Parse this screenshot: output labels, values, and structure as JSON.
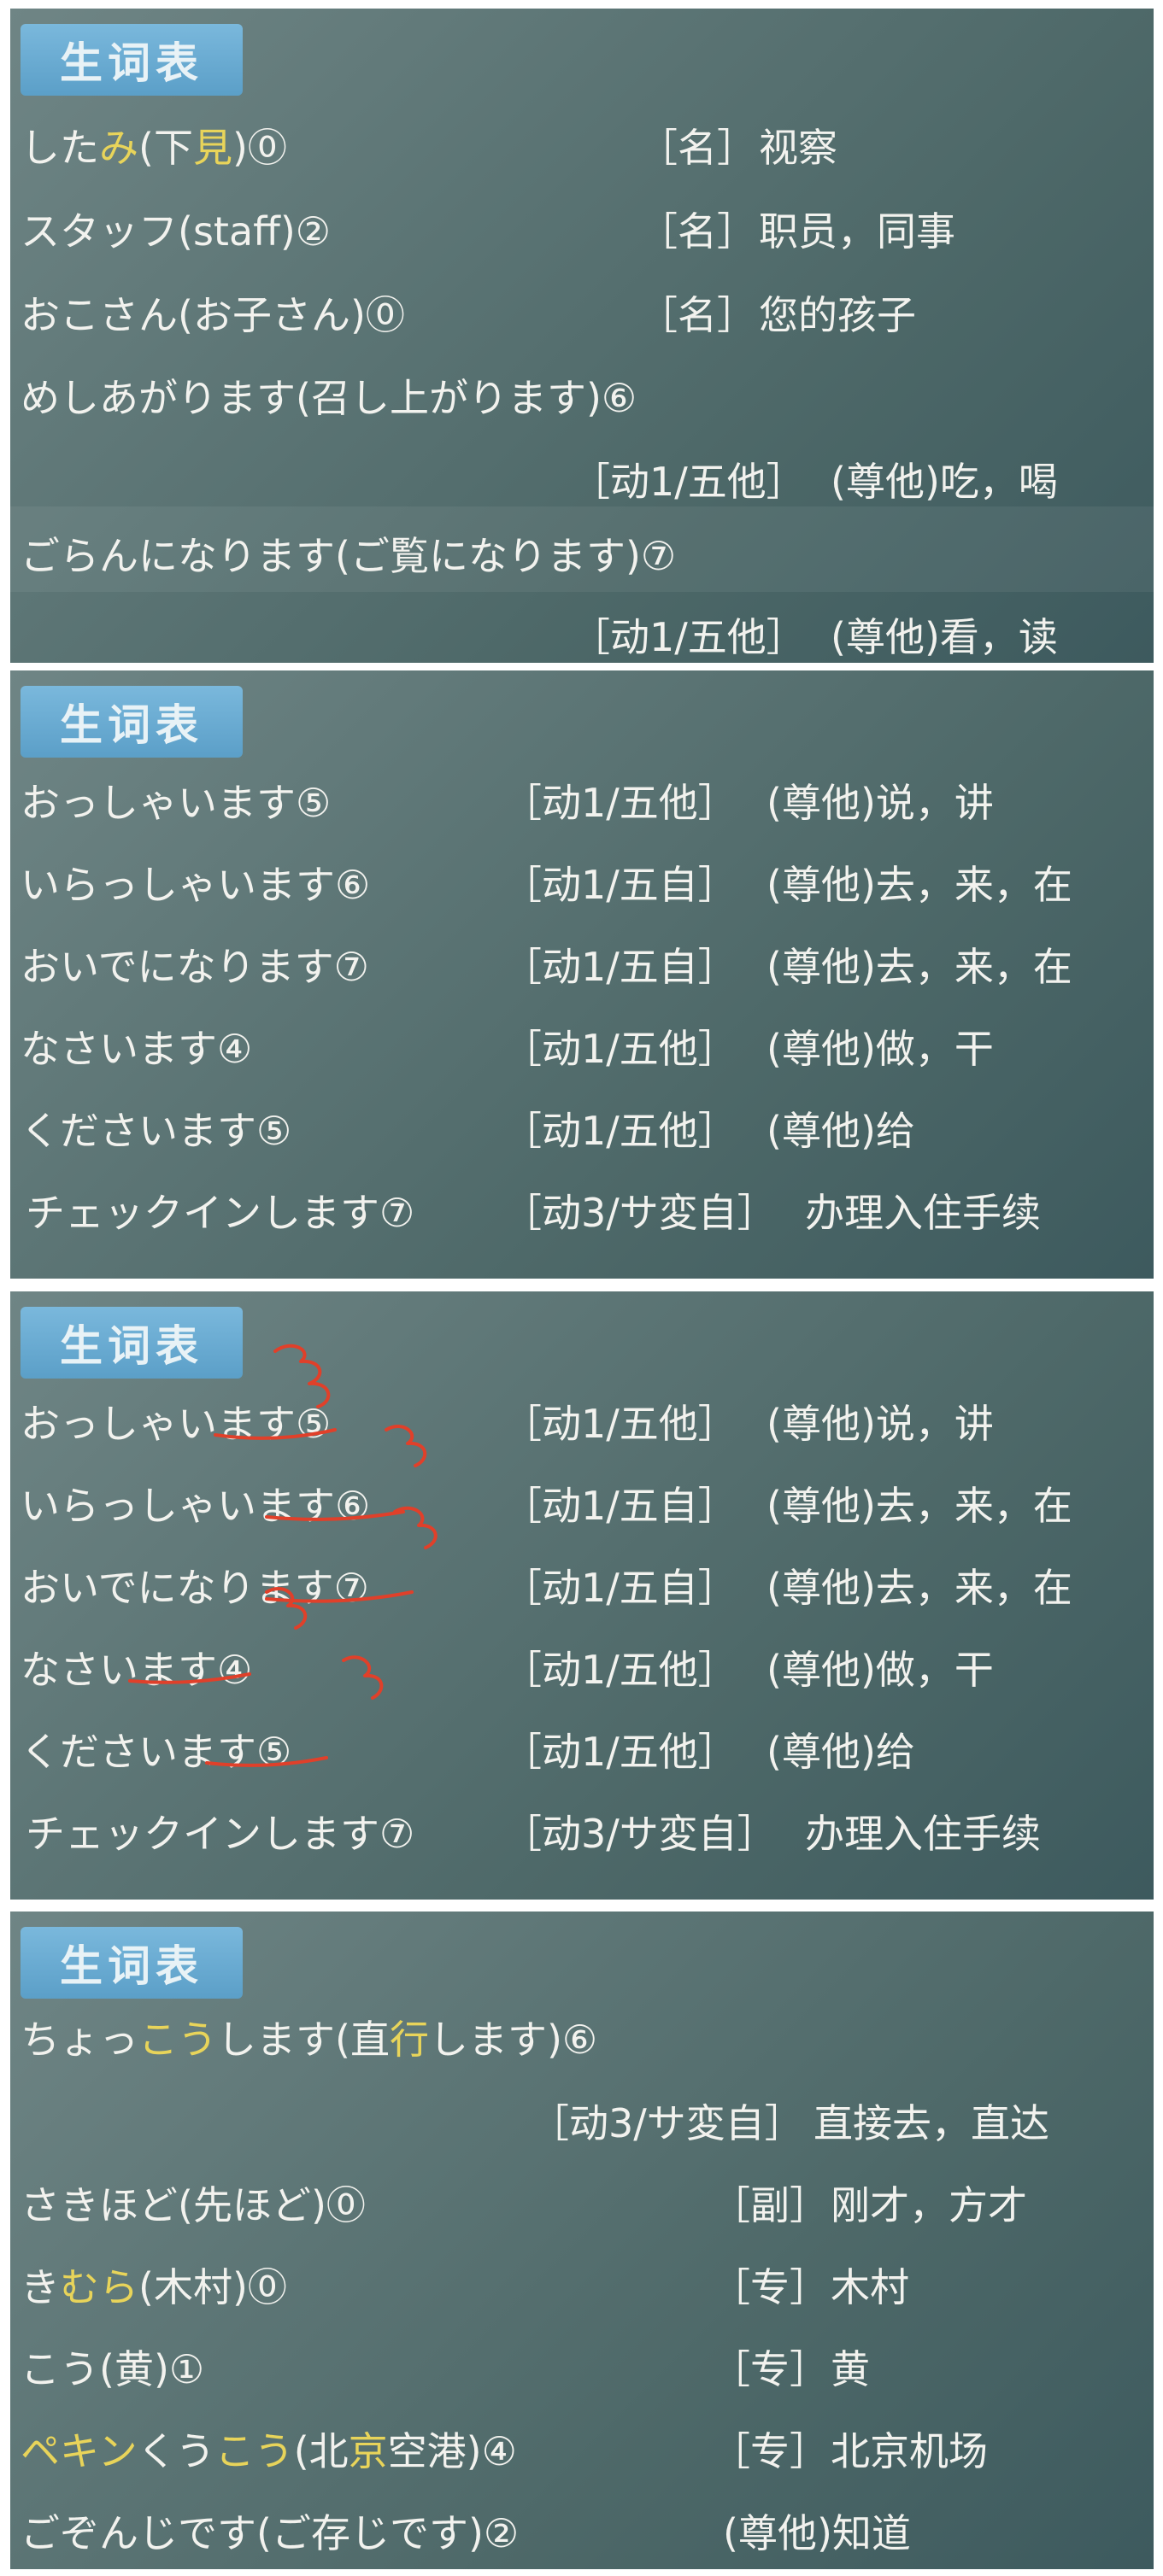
{
  "panels": [
    {
      "badge": "生词表",
      "rows": [
        {
          "kana_a": "した",
          "kana_b": "み",
          "paren_a": "(下",
          "paren_b": "見",
          "paren_c": ")",
          "accent": "⓪",
          "pos": "［名］",
          "gloss": "视察"
        },
        {
          "word": "スタッフ(staff)②",
          "pos": "［名］",
          "gloss": "职员，同事"
        },
        {
          "word": "おこさん(お子さん)⓪",
          "pos": "［名］",
          "gloss": "您的孩子"
        },
        {
          "word": "めしあがります(召し上がります)⑥",
          "pos": "［动1/五他］",
          "gloss": "(尊他)吃，喝"
        },
        {
          "word": "ごらんになります(ご覧になります)⑦",
          "pos": "［动1/五他］",
          "gloss": "(尊他)看，读"
        }
      ]
    },
    {
      "badge": "生词表",
      "rows": [
        {
          "word": "おっしゃいます⑤",
          "pos": "［动1/五他］",
          "gloss": "(尊他)说，讲"
        },
        {
          "word": "いらっしゃいます⑥",
          "pos": "［动1/五自］",
          "gloss": "(尊他)去，来，在"
        },
        {
          "word": "おいでになります⑦",
          "pos": "［动1/五自］",
          "gloss": "(尊他)去，来，在"
        },
        {
          "word": "なさいます④",
          "pos": "［动1/五他］",
          "gloss": "(尊他)做，干"
        },
        {
          "word": "くださいます⑤",
          "pos": "［动1/五他］",
          "gloss": "(尊他)给"
        },
        {
          "word": "チェックインします⑦",
          "pos": "［动3/サ変自］",
          "gloss": "办理入住手续"
        }
      ]
    },
    {
      "badge": "生词表",
      "rows": [
        {
          "word": "おっしゃいます⑤",
          "pos": "［动1/五他］",
          "gloss": "(尊他)说，讲"
        },
        {
          "word": "いらっしゃいます⑥",
          "pos": "［动1/五自］",
          "gloss": "(尊他)去，来，在"
        },
        {
          "word": "おいでになります⑦",
          "pos": "［动1/五自］",
          "gloss": "(尊他)去，来，在"
        },
        {
          "word": "なさいます④",
          "pos": "［动1/五他］",
          "gloss": "(尊他)做，干"
        },
        {
          "word": "くださいます⑤",
          "pos": "［动1/五他］",
          "gloss": "(尊他)给"
        },
        {
          "word": "チェックインします⑦",
          "pos": "［动3/サ変自］",
          "gloss": "办理入住手续"
        }
      ],
      "annotation_color": "#e0402a"
    },
    {
      "badge": "生词表",
      "rows": [
        {
          "w1": "ちょっ",
          "w2": "こう",
          "w3": "します(直",
          "w4": "行",
          "w5": "します)⑥",
          "pos": "［动3/サ変自］",
          "gloss": "直接去，直达"
        },
        {
          "word": "さきほど(先ほど)⓪",
          "pos": "［副］",
          "gloss": "刚才，方才"
        },
        {
          "w1": "き",
          "w2": "むら",
          "w3": "(木村)⓪",
          "pos": "［专］",
          "gloss": "木村"
        },
        {
          "word": "こう(黄)①",
          "pos": "［专］",
          "gloss": "黄"
        },
        {
          "w1": "ペ",
          "w2": "キン",
          "w3": "くう",
          "w4": "こう",
          "w5": "(北",
          "w6": "京",
          "w7": "空港",
          "w8": ")④",
          "pos": "［专］",
          "gloss": "北京机场"
        },
        {
          "word": "ごぞんじです(ご存じです)②",
          "gloss": "(尊他)知道"
        }
      ]
    }
  ],
  "colors": {
    "highlight": "#e8d45a",
    "text": "#f2f2ee",
    "badge": "#6aaed6"
  }
}
